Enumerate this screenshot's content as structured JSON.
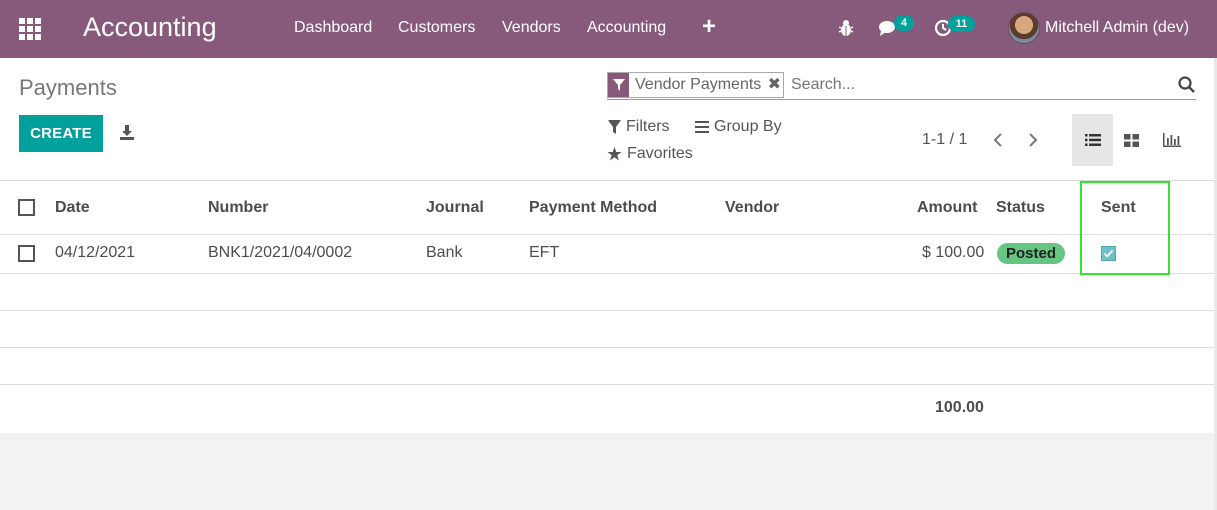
{
  "topbar": {
    "app_title": "Accounting",
    "menu": [
      "Dashboard",
      "Customers",
      "Vendors",
      "Accounting"
    ],
    "plus_label": "+",
    "chat_count": "4",
    "activity_count": "11",
    "user_name": "Mitchell Admin (dev)",
    "bg_color": "#875a7b"
  },
  "control_panel": {
    "title": "Payments",
    "create_label": "CREATE",
    "facet_label": "Vendor Payments",
    "facet_close": "✖",
    "search_placeholder": "Search...",
    "filters_label": "Filters",
    "group_by_label": "Group By",
    "favorites_label": "Favorites",
    "pager": "1-1 / 1",
    "accent_color": "#00a09d"
  },
  "table": {
    "columns": [
      "Date",
      "Number",
      "Journal",
      "Payment Method",
      "Vendor",
      "Amount",
      "Status",
      "Sent"
    ],
    "rows": [
      {
        "date": "04/12/2021",
        "number": "BNK1/2021/04/0002",
        "journal": "Bank",
        "payment_method": "EFT",
        "vendor": "",
        "amount": "$ 100.00",
        "status": "Posted",
        "sent": true
      }
    ],
    "total_amount": "100.00",
    "status_color": "#65c581"
  }
}
